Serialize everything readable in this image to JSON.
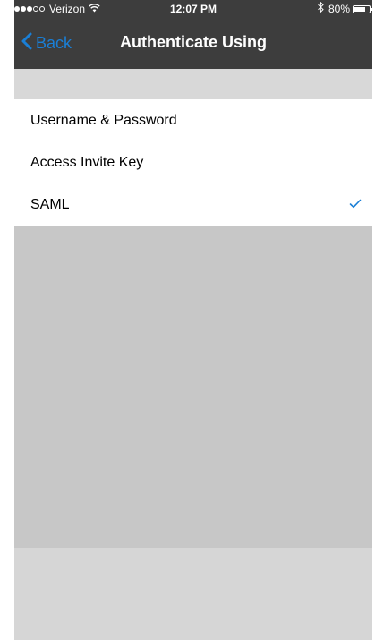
{
  "status_bar": {
    "carrier": "Verizon",
    "signal_bars_filled": 3,
    "signal_bars_total": 5,
    "time": "12:07 PM",
    "battery_percent": "80%",
    "battery_level": 0.8
  },
  "nav": {
    "back_label": "Back",
    "title": "Authenticate Using"
  },
  "auth_options": [
    {
      "label": "Username & Password",
      "selected": false
    },
    {
      "label": "Access Invite Key",
      "selected": false
    },
    {
      "label": "SAML",
      "selected": true
    }
  ],
  "colors": {
    "accent": "#1a7fd6",
    "nav_background": "#3d3d3d",
    "content_background": "#c7c7c7"
  },
  "icons": {
    "wifi": "wifi-icon",
    "bluetooth": "bluetooth-icon",
    "battery": "battery-icon",
    "back": "chevron-left-icon",
    "selected": "checkmark-icon"
  }
}
